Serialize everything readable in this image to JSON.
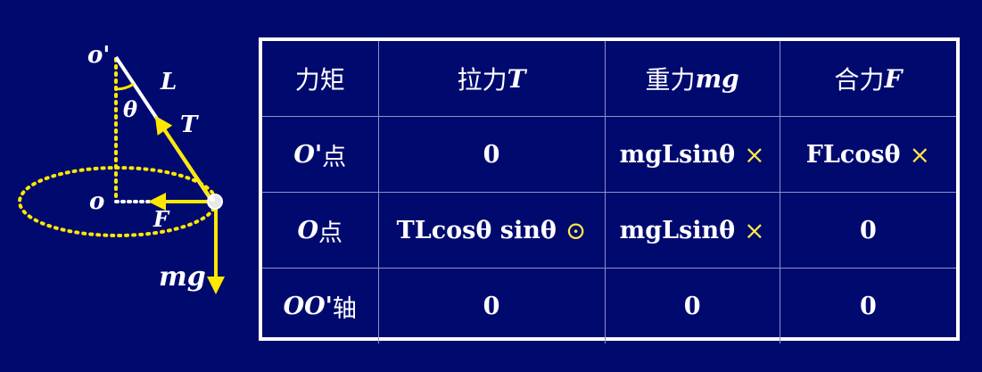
{
  "diagram": {
    "labels": {
      "pivot": "o'",
      "length": "L",
      "angle": "θ",
      "tension": "T",
      "center": "o",
      "net_force": "F",
      "gravity": "mg"
    },
    "colors": {
      "background": "#000a6e",
      "vectors": "#ffe800",
      "guides": "#ffe800"
    }
  },
  "table": {
    "header": {
      "c0": "力矩",
      "c1_text": "拉力",
      "c1_sym": "T",
      "c2_text": "重力",
      "c2_sym": "mg",
      "c3_text": "合力",
      "c3_sym": "F"
    },
    "rows": [
      {
        "label_sym": "O'",
        "label_text": "点",
        "c1": "0",
        "c2": "mgLsinθ",
        "c2_mark": "×",
        "c3": "FLcosθ",
        "c3_mark": "×"
      },
      {
        "label_sym": "O",
        "label_text": "点",
        "c1": "TLcosθ sinθ",
        "c1_mark": "⊙",
        "c2": "mgLsinθ",
        "c2_mark": "×",
        "c3": "0"
      },
      {
        "label_sym": "OO'",
        "label_text": "轴",
        "c1": "0",
        "c2": "0",
        "c3": "0"
      }
    ]
  }
}
